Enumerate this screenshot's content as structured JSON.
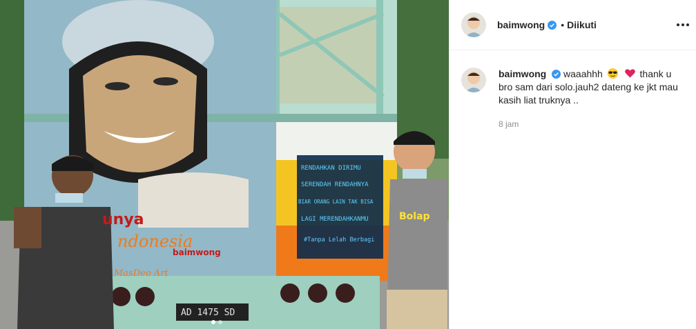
{
  "post": {
    "author": "baimwong",
    "follow_status": "Diikuti",
    "separator": "•"
  },
  "photo": {
    "truck_text_lines": [
      "RENDAHKAN DIRIMU",
      "SERENDAH RENDAHNYA",
      "BIAR ORANG LAIN TAK BISA",
      "LAGI MERENDAHKANMU",
      "#Tanpa Lelah Berbagi"
    ],
    "brand": "baimwong",
    "word_a": "unya",
    "word_b": "ndonesia",
    "signature": "MasDeo Art",
    "plate": "AD 1475 SD",
    "shirt_text": "Bolap"
  },
  "caption": {
    "username": "baimwong",
    "text_before_emoji": "waaahhh",
    "text_after_emoji": "thank u bro sam dari solo.jauh2 dateng ke jkt mau kasih liat truknya ..",
    "time": "8 jam"
  },
  "colors": {
    "verified": "#3897f0",
    "text": "#262626",
    "muted": "#8e8e8e"
  },
  "icons": [
    "verified-badge-icon",
    "more-options-icon",
    "sunglasses-emoji-icon",
    "heart-emoji-icon"
  ]
}
